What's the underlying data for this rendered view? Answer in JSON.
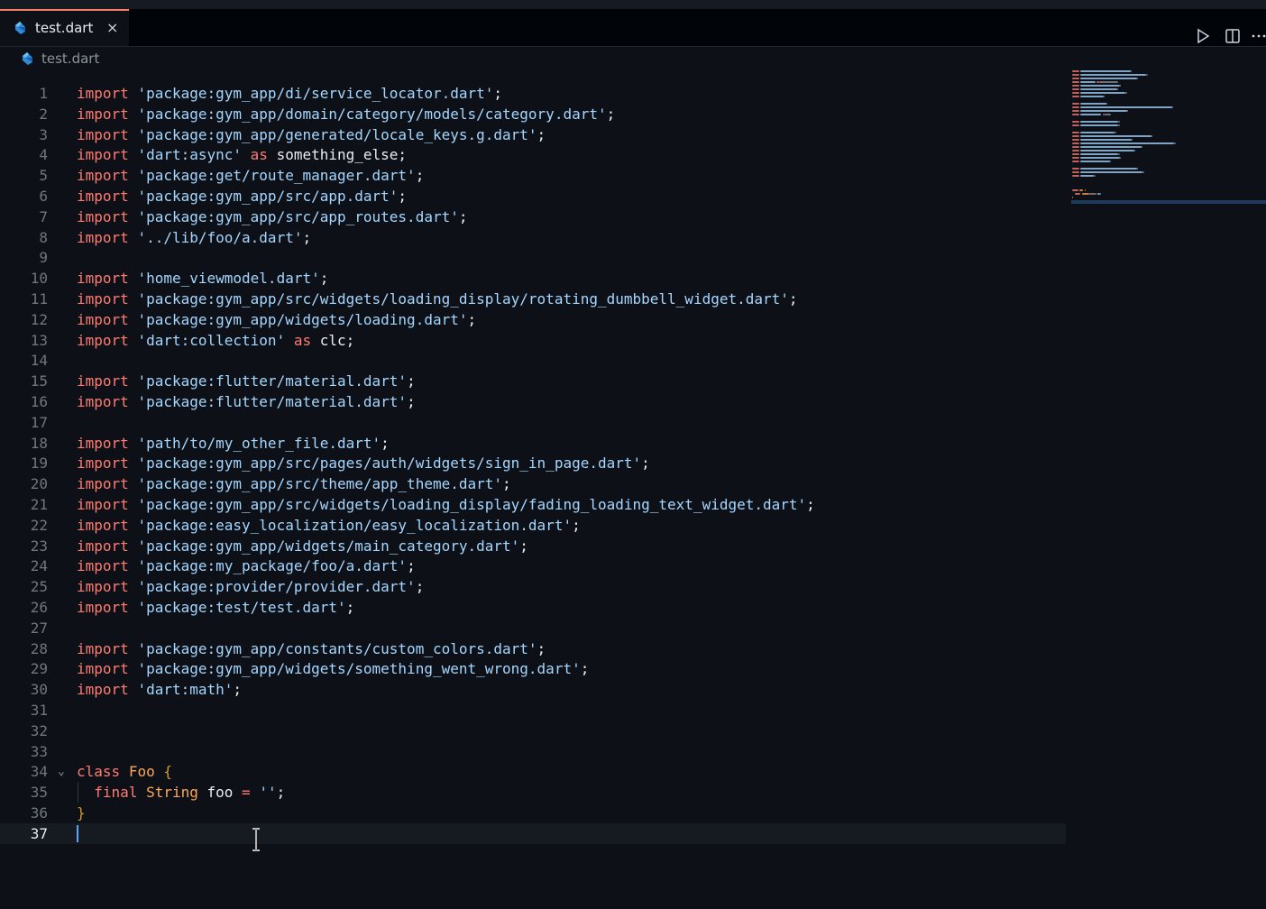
{
  "tab": {
    "label": "test.dart",
    "close": "×"
  },
  "breadcrumb": {
    "label": "test.dart"
  },
  "icons": {
    "file": "dart-file-icon",
    "run": "run-icon",
    "split": "split-editor-icon",
    "more": "more-actions-icon"
  },
  "colors": {
    "keyword": "#ff7b72",
    "string": "#a5d6ff",
    "type": "#ffa657",
    "brace": "#d29922",
    "accent": "#f78166",
    "caret": "#58a6ff"
  },
  "editor": {
    "active_line": 37,
    "lines": [
      {
        "n": "1",
        "code": [
          {
            "t": "import",
            "c": "kw"
          },
          {
            "t": " "
          },
          {
            "t": "'package:gym_app/di/service_locator.dart'",
            "c": "str"
          },
          {
            "t": ";"
          }
        ]
      },
      {
        "n": "2",
        "code": [
          {
            "t": "import",
            "c": "kw"
          },
          {
            "t": " "
          },
          {
            "t": "'package:gym_app/domain/category/models/category.dart'",
            "c": "str"
          },
          {
            "t": ";"
          }
        ]
      },
      {
        "n": "3",
        "code": [
          {
            "t": "import",
            "c": "kw"
          },
          {
            "t": " "
          },
          {
            "t": "'package:gym_app/generated/locale_keys.g.dart'",
            "c": "str"
          },
          {
            "t": ";"
          }
        ]
      },
      {
        "n": "4",
        "code": [
          {
            "t": "import",
            "c": "kw"
          },
          {
            "t": " "
          },
          {
            "t": "'dart:async'",
            "c": "str"
          },
          {
            "t": " "
          },
          {
            "t": "as",
            "c": "kw"
          },
          {
            "t": " something_else;"
          }
        ]
      },
      {
        "n": "5",
        "code": [
          {
            "t": "import",
            "c": "kw"
          },
          {
            "t": " "
          },
          {
            "t": "'package:get/route_manager.dart'",
            "c": "str"
          },
          {
            "t": ";"
          }
        ]
      },
      {
        "n": "6",
        "code": [
          {
            "t": "import",
            "c": "kw"
          },
          {
            "t": " "
          },
          {
            "t": "'package:gym_app/src/app.dart'",
            "c": "str"
          },
          {
            "t": ";"
          }
        ]
      },
      {
        "n": "7",
        "code": [
          {
            "t": "import",
            "c": "kw"
          },
          {
            "t": " "
          },
          {
            "t": "'package:gym_app/src/app_routes.dart'",
            "c": "str"
          },
          {
            "t": ";"
          }
        ]
      },
      {
        "n": "8",
        "code": [
          {
            "t": "import",
            "c": "kw"
          },
          {
            "t": " "
          },
          {
            "t": "'../lib/foo/a.dart'",
            "c": "str"
          },
          {
            "t": ";"
          }
        ]
      },
      {
        "n": "9",
        "code": []
      },
      {
        "n": "10",
        "code": [
          {
            "t": "import",
            "c": "kw"
          },
          {
            "t": " "
          },
          {
            "t": "'home_viewmodel.dart'",
            "c": "str"
          },
          {
            "t": ";"
          }
        ]
      },
      {
        "n": "11",
        "code": [
          {
            "t": "import",
            "c": "kw"
          },
          {
            "t": " "
          },
          {
            "t": "'package:gym_app/src/widgets/loading_display/rotating_dumbbell_widget.dart'",
            "c": "str"
          },
          {
            "t": ";"
          }
        ]
      },
      {
        "n": "12",
        "code": [
          {
            "t": "import",
            "c": "kw"
          },
          {
            "t": " "
          },
          {
            "t": "'package:gym_app/widgets/loading.dart'",
            "c": "str"
          },
          {
            "t": ";"
          }
        ]
      },
      {
        "n": "13",
        "code": [
          {
            "t": "import",
            "c": "kw"
          },
          {
            "t": " "
          },
          {
            "t": "'dart:collection'",
            "c": "str"
          },
          {
            "t": " "
          },
          {
            "t": "as",
            "c": "kw"
          },
          {
            "t": " clc;"
          }
        ]
      },
      {
        "n": "14",
        "code": []
      },
      {
        "n": "15",
        "code": [
          {
            "t": "import",
            "c": "kw"
          },
          {
            "t": " "
          },
          {
            "t": "'package:flutter/material.dart'",
            "c": "str"
          },
          {
            "t": ";"
          }
        ]
      },
      {
        "n": "16",
        "code": [
          {
            "t": "import",
            "c": "kw"
          },
          {
            "t": " "
          },
          {
            "t": "'package:flutter/material.dart'",
            "c": "str"
          },
          {
            "t": ";"
          }
        ]
      },
      {
        "n": "17",
        "code": []
      },
      {
        "n": "18",
        "code": [
          {
            "t": "import",
            "c": "kw"
          },
          {
            "t": " "
          },
          {
            "t": "'path/to/my_other_file.dart'",
            "c": "str"
          },
          {
            "t": ";"
          }
        ]
      },
      {
        "n": "19",
        "code": [
          {
            "t": "import",
            "c": "kw"
          },
          {
            "t": " "
          },
          {
            "t": "'package:gym_app/src/pages/auth/widgets/sign_in_page.dart'",
            "c": "str"
          },
          {
            "t": ";"
          }
        ]
      },
      {
        "n": "20",
        "code": [
          {
            "t": "import",
            "c": "kw"
          },
          {
            "t": " "
          },
          {
            "t": "'package:gym_app/src/theme/app_theme.dart'",
            "c": "str"
          },
          {
            "t": ";"
          }
        ]
      },
      {
        "n": "21",
        "code": [
          {
            "t": "import",
            "c": "kw"
          },
          {
            "t": " "
          },
          {
            "t": "'package:gym_app/src/widgets/loading_display/fading_loading_text_widget.dart'",
            "c": "str"
          },
          {
            "t": ";"
          }
        ]
      },
      {
        "n": "22",
        "code": [
          {
            "t": "import",
            "c": "kw"
          },
          {
            "t": " "
          },
          {
            "t": "'package:easy_localization/easy_localization.dart'",
            "c": "str"
          },
          {
            "t": ";"
          }
        ]
      },
      {
        "n": "23",
        "code": [
          {
            "t": "import",
            "c": "kw"
          },
          {
            "t": " "
          },
          {
            "t": "'package:gym_app/widgets/main_category.dart'",
            "c": "str"
          },
          {
            "t": ";"
          }
        ]
      },
      {
        "n": "24",
        "code": [
          {
            "t": "import",
            "c": "kw"
          },
          {
            "t": " "
          },
          {
            "t": "'package:my_package/foo/a.dart'",
            "c": "str"
          },
          {
            "t": ";"
          }
        ]
      },
      {
        "n": "25",
        "code": [
          {
            "t": "import",
            "c": "kw"
          },
          {
            "t": " "
          },
          {
            "t": "'package:provider/provider.dart'",
            "c": "str"
          },
          {
            "t": ";"
          }
        ]
      },
      {
        "n": "26",
        "code": [
          {
            "t": "import",
            "c": "kw"
          },
          {
            "t": " "
          },
          {
            "t": "'package:test/test.dart'",
            "c": "str"
          },
          {
            "t": ";"
          }
        ]
      },
      {
        "n": "27",
        "code": []
      },
      {
        "n": "28",
        "code": [
          {
            "t": "import",
            "c": "kw"
          },
          {
            "t": " "
          },
          {
            "t": "'package:gym_app/constants/custom_colors.dart'",
            "c": "str"
          },
          {
            "t": ";"
          }
        ]
      },
      {
        "n": "29",
        "code": [
          {
            "t": "import",
            "c": "kw"
          },
          {
            "t": " "
          },
          {
            "t": "'package:gym_app/widgets/something_went_wrong.dart'",
            "c": "str"
          },
          {
            "t": ";"
          }
        ]
      },
      {
        "n": "30",
        "code": [
          {
            "t": "import",
            "c": "kw"
          },
          {
            "t": " "
          },
          {
            "t": "'dart:math'",
            "c": "str"
          },
          {
            "t": ";"
          }
        ]
      },
      {
        "n": "31",
        "code": []
      },
      {
        "n": "32",
        "code": []
      },
      {
        "n": "33",
        "code": []
      },
      {
        "n": "34",
        "fold": true,
        "code": [
          {
            "t": "class",
            "c": "kw"
          },
          {
            "t": " "
          },
          {
            "t": "Foo",
            "c": "typ"
          },
          {
            "t": " "
          },
          {
            "t": "{",
            "c": "brace"
          }
        ]
      },
      {
        "n": "35",
        "guide": true,
        "code": [
          {
            "t": "  "
          },
          {
            "t": "final",
            "c": "kw"
          },
          {
            "t": " "
          },
          {
            "t": "String",
            "c": "typ"
          },
          {
            "t": " foo "
          },
          {
            "t": "=",
            "c": "kw"
          },
          {
            "t": " "
          },
          {
            "t": "''",
            "c": "str"
          },
          {
            "t": ";"
          }
        ]
      },
      {
        "n": "36",
        "code": [
          {
            "t": "}",
            "c": "brace"
          }
        ]
      },
      {
        "n": "37",
        "code": []
      }
    ]
  }
}
